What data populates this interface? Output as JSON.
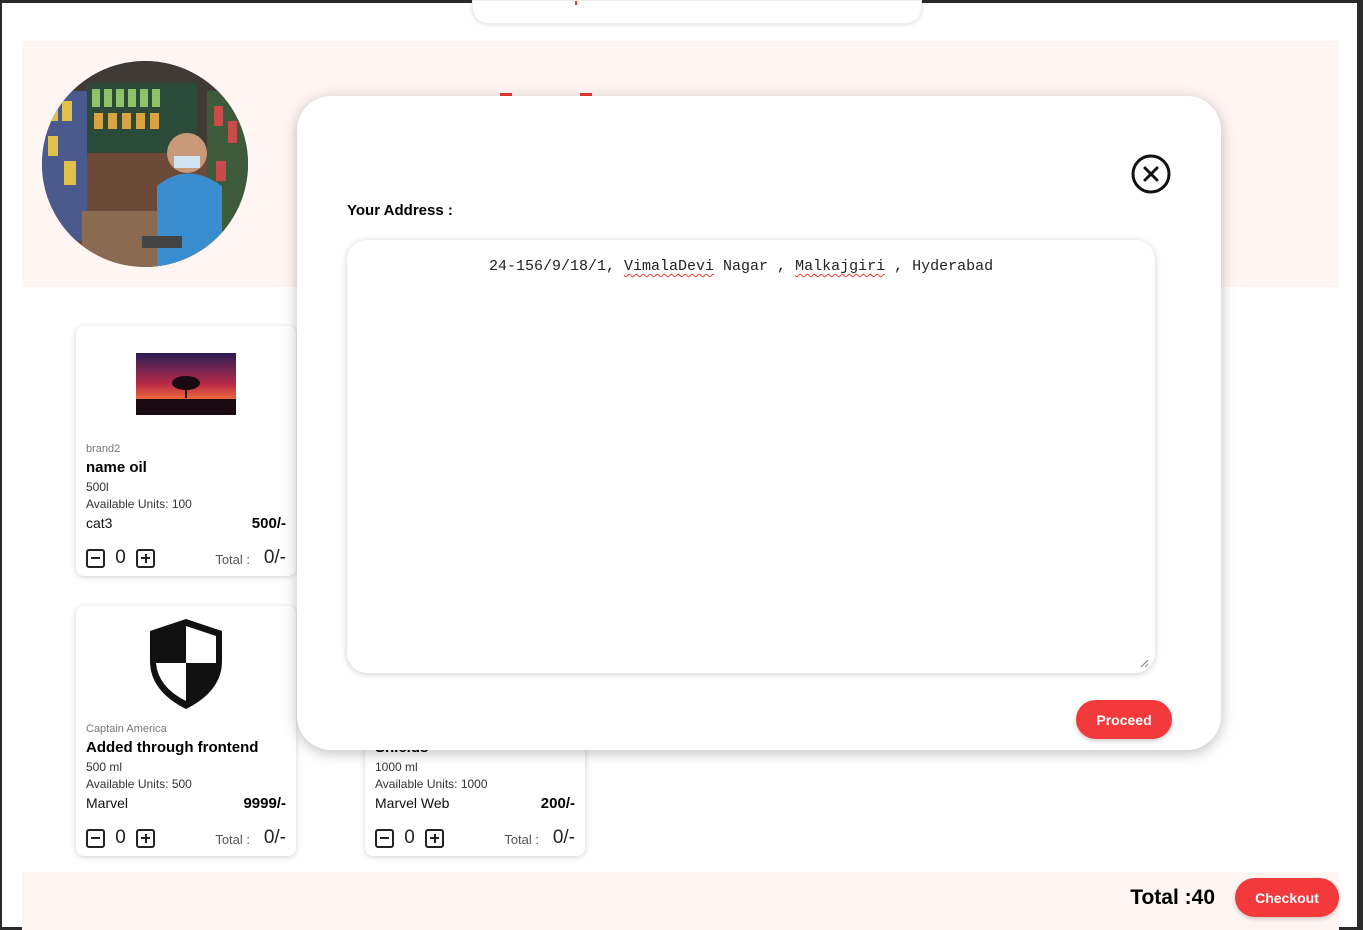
{
  "shop": {
    "photo_alt": ""
  },
  "products": [
    {
      "brand": "brand2",
      "name": "name oil",
      "quantity": "500l",
      "available": "Available Units: 100",
      "category": "cat3",
      "price": "500/-",
      "count": "0",
      "total_label": "Total :",
      "total_value": "0/-",
      "image": "sunset-tree-image"
    },
    {
      "brand": "Captain America",
      "name": "Added through frontend",
      "quantity": "500 ml",
      "available": "Available Units: 500",
      "category": "Marvel",
      "price": "9999/-",
      "count": "0",
      "total_label": "Total :",
      "total_value": "0/-",
      "image": "shield-icon"
    },
    {
      "brand": "",
      "name": "Shields",
      "quantity": "1000 ml",
      "available": "Available Units: 1000",
      "category": "Marvel Web",
      "price": "200/-",
      "count": "0",
      "total_label": "Total :",
      "total_value": "0/-",
      "image": ""
    }
  ],
  "footer": {
    "total": "Total :40",
    "checkout_label": "Checkout"
  },
  "modal": {
    "address_label": "Your Address :",
    "address_parts": [
      "24-156/9/18/1, ",
      "VimalaDevi",
      " Nagar , ",
      "Malkajgiri",
      " , Hyderabad"
    ],
    "proceed_label": "Proceed",
    "close_icon": "close-circle-icon"
  },
  "colors": {
    "accent": "#f23a3c",
    "panel_bg": "#fff5f3"
  }
}
